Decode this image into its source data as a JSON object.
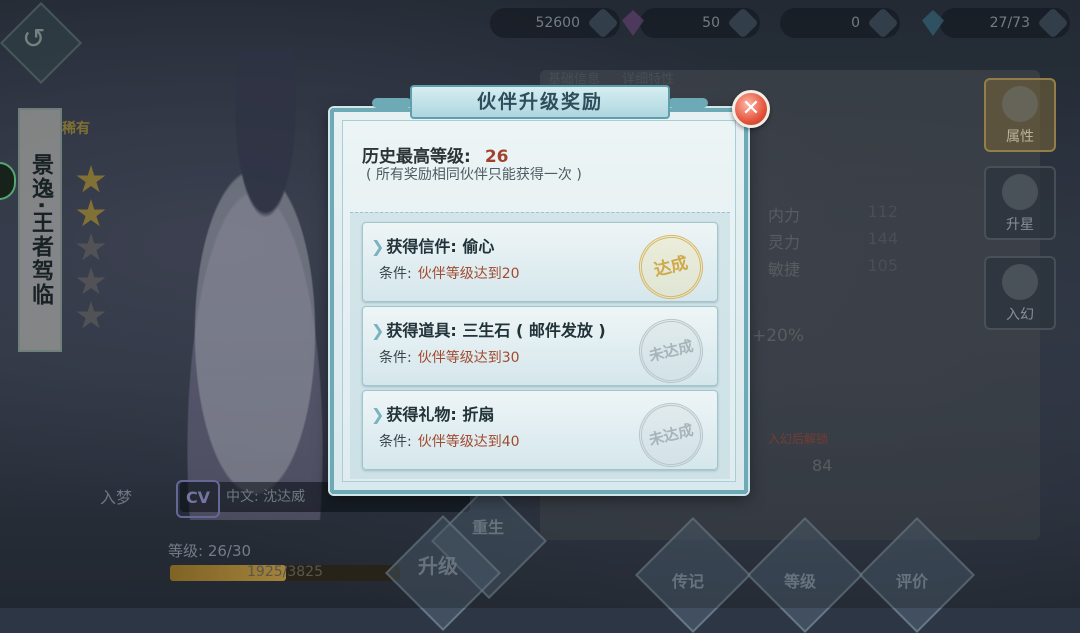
{
  "top_bar": {
    "coins": "52600",
    "gems": "50",
    "gold_ingots": "0",
    "stamina": "27/73"
  },
  "character": {
    "name": "景逸·王者驾临",
    "rarity_label": "稀有",
    "stars_total": 5,
    "stars_filled": 2,
    "cv_badge": "CV",
    "cv_text": "中文: 沈达威",
    "ruyin_label": "入梦",
    "level_label": "等级: 26/30",
    "exp_text": "1925/3825",
    "exp_progress": 0.503
  },
  "bottom_actions": {
    "rebirth": "重生",
    "upgrade": "升级",
    "biography": "传记",
    "grade": "等级",
    "review": "评价"
  },
  "right_tabs": [
    {
      "label": "属性",
      "icon": "fox-mask-icon",
      "active": true
    },
    {
      "label": "升星",
      "icon": "hexagram-icon",
      "active": false
    },
    {
      "label": "入幻",
      "icon": "butterfly-icon",
      "active": false
    }
  ],
  "info_tabs": [
    "基础信息",
    "详细特性"
  ],
  "attributes": [
    {
      "name": "内力",
      "value": "112"
    },
    {
      "name": "灵力",
      "value": "144"
    },
    {
      "name": "敏捷",
      "value": "105"
    }
  ],
  "bonus_text": "+20%",
  "unlock_text": "入幻后解锁",
  "misc_number": "84",
  "dialog": {
    "title": "伙伴升级奖励",
    "close_symbol": "✕",
    "history_label": "历史最高等级:",
    "history_value": "26",
    "note": "( 所有奖励相同伙伴只能获得一次 )",
    "rewards": [
      {
        "title": "获得信件: 偷心",
        "cond_label": "条件:",
        "cond_value": "伙伴等级达到20",
        "status": "达成",
        "achieved": true
      },
      {
        "title": "获得道具: 三生石 ( 邮件发放 )",
        "cond_label": "条件:",
        "cond_value": "伙伴等级达到30",
        "status": "未达成",
        "achieved": false
      },
      {
        "title": "获得礼物: 折扇",
        "cond_label": "条件:",
        "cond_value": "伙伴等级达到40",
        "status": "未达成",
        "achieved": false
      }
    ]
  }
}
